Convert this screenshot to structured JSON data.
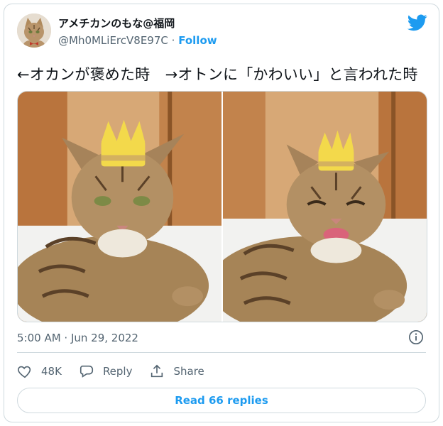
{
  "author": {
    "display_name": "アメチカンのもな@福岡",
    "handle": "@Mh0MLiErcV8E97C",
    "separator": "·",
    "follow_label": "Follow",
    "avatar_icon": "cat-avatar-icon"
  },
  "brand": {
    "logo_icon": "twitter-bird-icon",
    "color": "#1d9bf0"
  },
  "tweet": {
    "text": "←オカンが褒めた時　→オトンに「かわいい」と言われた時",
    "media": [
      {
        "icon": "cat-with-crown-photo",
        "caption": ""
      },
      {
        "icon": "smiling-cat-with-crown-photo",
        "caption": ""
      }
    ]
  },
  "meta": {
    "timestamp": "5:00 AM · Jun 29, 2022",
    "info_icon": "info-icon"
  },
  "actions": {
    "like_count": "48K",
    "like_icon": "heart-icon",
    "reply_label": "Reply",
    "reply_icon": "reply-icon",
    "share_label": "Share",
    "share_icon": "share-icon"
  },
  "read_replies_label": "Read 66 replies",
  "colors": {
    "text": "#0f1419",
    "secondary": "#536471",
    "border": "#cfd9de",
    "link": "#1d9bf0"
  }
}
